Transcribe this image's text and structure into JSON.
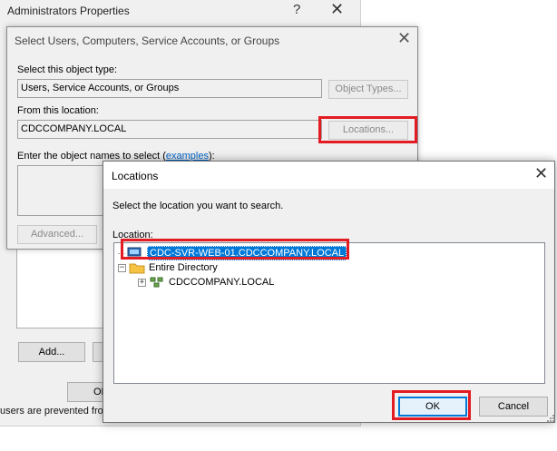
{
  "admin_window": {
    "title": "Administrators Properties",
    "help_glyph": "?",
    "close_glyph": "✕",
    "add_button": "Add...",
    "ok_button": "OK",
    "footer_text": "users are prevented from"
  },
  "select_dialog": {
    "title": "Select Users, Computers, Service Accounts, or Groups",
    "close_glyph": "✕",
    "object_type_label": "Select this object type:",
    "object_type_value": "Users, Service Accounts, or Groups",
    "object_types_button": "Object Types...",
    "location_label": "From this location:",
    "location_value": "CDCCOMPANY.LOCAL",
    "locations_button": "Locations...",
    "names_label_prefix": "Enter the object names to select (",
    "names_label_link": "examples",
    "names_label_suffix": "):",
    "advanced_button": "Advanced..."
  },
  "locations_dialog": {
    "title": "Locations",
    "close_glyph": "✕",
    "instruction": "Select the location you want to search.",
    "location_label": "Location:",
    "tree": {
      "selected_computer": "CDC-SVR-WEB-01.CDCCOMPANY.LOCAL",
      "entire_directory": "Entire Directory",
      "domain": "CDCCOMPANY.LOCAL",
      "expand_glyph": "+",
      "collapse_glyph": "−"
    },
    "ok_button": "OK",
    "cancel_button": "Cancel"
  },
  "colors": {
    "highlight_red": "#e31b23",
    "selection_blue": "#0078d7",
    "link_blue": "#0066cc"
  }
}
